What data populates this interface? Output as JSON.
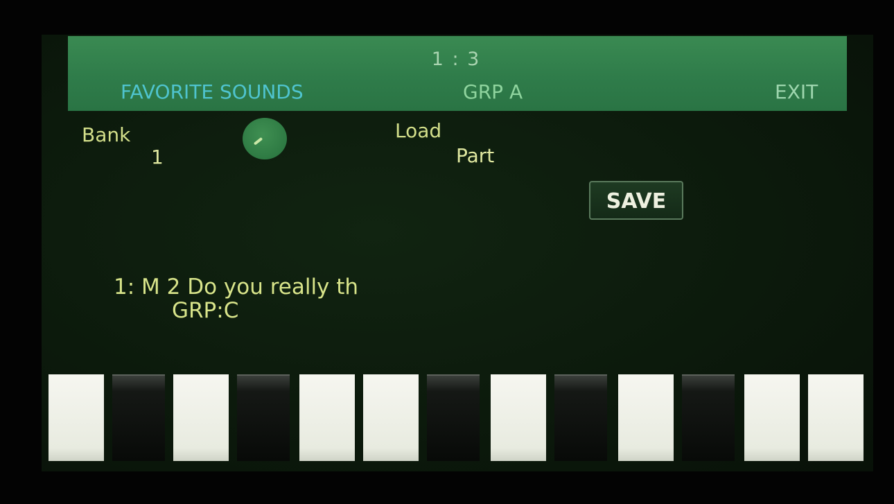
{
  "header": {
    "slot": "1 : 3",
    "title": "FAVORITE SOUNDS",
    "group": "GRP A",
    "exit_label": "EXIT"
  },
  "params": {
    "bank_label": "Bank",
    "bank_value": "1",
    "load_label": "Load",
    "load_value": "Part"
  },
  "save_label": "SAVE",
  "sound": {
    "line1": "1: M  2 Do you really th",
    "line2": "GRP:C"
  },
  "keys": [
    "white",
    "black",
    "white",
    "black",
    "white",
    "white",
    "black",
    "white",
    "black",
    "white",
    "black",
    "white",
    "white"
  ],
  "colors": {
    "header_bg": "#2f7c4a",
    "header_title": "#4fc4cf",
    "text_yellow": "#d8e48a",
    "screen_bg": "#0c1a0c"
  }
}
